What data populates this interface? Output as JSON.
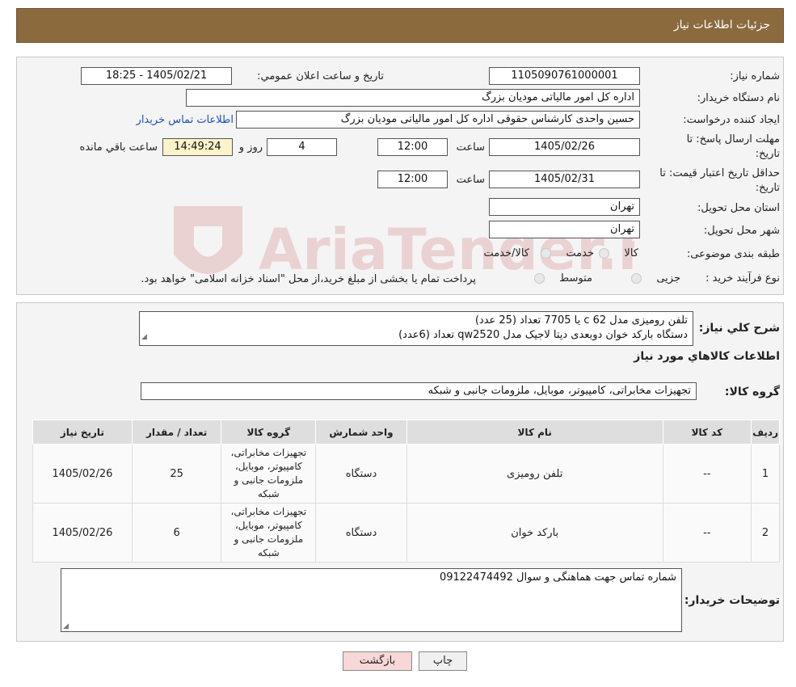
{
  "header": {
    "title": "جزئیات اطلاعات نیاز"
  },
  "form": {
    "need_number_label": "شماره نیاز:",
    "need_number": "1105090761000001",
    "announce_label": "تاریخ و ساعت اعلان عمومي:",
    "announce_value": "1405/02/21 - 18:25",
    "buyer_org_label": "نام دستگاه خريدار:",
    "buyer_org": "اداره کل امور مالیاتی مودیان بزرگ",
    "requester_label": "ايجاد كننده درخواست:",
    "requester": "حسین واحدی کارشناس حقوقی اداره کل امور مالیاتی مودیان بزرگ",
    "contact_link": "اطلاعات تماس خريدار",
    "deadline_label_1": "مهلت ارسال پاسخ: تا",
    "deadline_label_2": "تاریخ:",
    "deadline_date": "1405/02/26",
    "time_label": "ساعت",
    "deadline_time": "12:00",
    "days": "4",
    "days_label": "روز و",
    "remaining_time": "14:49:24",
    "remaining_label": "ساعت باقي مانده",
    "validity_label_1": "حداقل تاريخ اعتبار قيمت: تا",
    "validity_label_2": "تاريخ:",
    "validity_date": "1405/02/31",
    "validity_time": "12:00",
    "province_label": "استان محل تحويل:",
    "province": "تهران",
    "city_label": "شهر محل تحويل:",
    "city": "تهران",
    "category_label": "طبقه بندی موضوعی:",
    "category_options": [
      "کالا",
      "خدمت",
      "کالا/خدمت"
    ],
    "purchase_type_label": "نوع فرآیند خرید :",
    "purchase_options": [
      "جزیی",
      "متوسط"
    ],
    "purchase_note": "پرداخت تمام یا بخشی از مبلغ خرید،از محل \"اسناد خزانه اسلامی\" خواهد بود."
  },
  "summary": {
    "label": "شرح کلي نياز:",
    "line1": "تلفن رومیزی مدل   c 62   یا  7705  تعداد (25 عدد)",
    "line2": "دستگاه بارکد خوان دوبعدی دیتا لاجیک مدل qw2520  تعداد (6عدد)"
  },
  "goods_info_title": "اطلاعات کالاهاي مورد نياز",
  "goods_group": {
    "label": "گروه کالا:",
    "value": "تجهیزات مخابراتی، کامپیوتر، موبایل، ملزومات جانبی و شبکه"
  },
  "table": {
    "headers": [
      "رديف",
      "کد کالا",
      "نام کالا",
      "واحد شمارش",
      "گروه کالا",
      "تعداد / مقدار",
      "تاريخ نياز"
    ],
    "rows": [
      {
        "index": "1",
        "code": "--",
        "name": "تلفن رومیزی",
        "unit": "دستگاه",
        "group": "تجهیزات مخابراتی، کامپیوتر، موبایل، ملزومات جانبی و شبکه",
        "qty": "25",
        "date": "1405/02/26"
      },
      {
        "index": "2",
        "code": "--",
        "name": "بارکد خوان",
        "unit": "دستگاه",
        "group": "تجهیزات مخابراتی، کامپیوتر، موبایل، ملزومات جانبی و شبکه",
        "qty": "6",
        "date": "1405/02/26"
      }
    ]
  },
  "buyer_notes": {
    "label": "توضيحات خريدار:",
    "value": "شماره تماس جهت هماهنگی و سوال 09122474492"
  },
  "buttons": {
    "print": "چاپ",
    "back": "بازگشت"
  },
  "watermark": {
    "text": "AriaTender.neT"
  },
  "colors": {
    "header": "#8b6a3e",
    "link": "#1f4fb5",
    "back_button": "#f8d7d7",
    "print_button": "#f0f0f0",
    "remaining_box": "#fbf3c9"
  }
}
